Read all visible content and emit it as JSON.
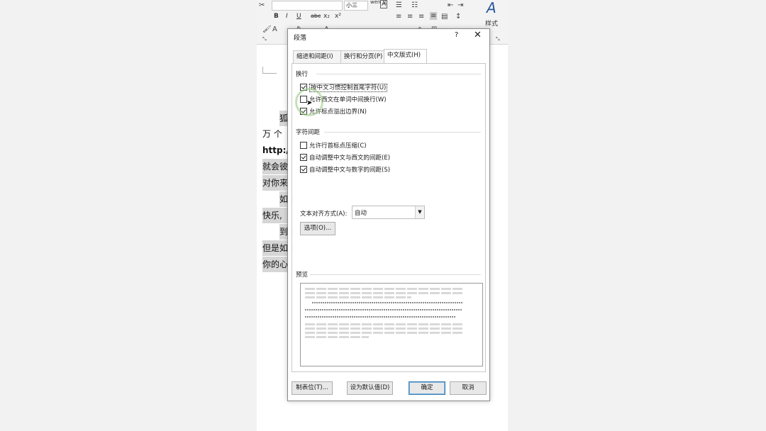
{
  "ribbon": {
    "font_size_value": "小三",
    "phonetic_label": "wén\n文",
    "styles_label": "样式",
    "bold": "B",
    "italic": "I",
    "underline": "U",
    "strike": "abc",
    "subscript": "x₂",
    "superscript": "x²"
  },
  "document": {
    "lines": [
      "狐",
      "万 个",
      "http://",
      "就会彼",
      "对你来",
      "如",
      "快乐,",
      "到",
      "但是如",
      "你的心"
    ]
  },
  "dialog": {
    "title": "段落",
    "help": "?",
    "close": "✕",
    "tabs": [
      "缩进和间距(I)",
      "换行和分页(P)",
      "中文版式(H)"
    ],
    "section_wrap": {
      "title": "换行",
      "items": [
        {
          "label": "按中文习惯控制首尾字符(U)",
          "checked": true
        },
        {
          "label": "允许西文在单词中间换行(W)",
          "checked": false
        },
        {
          "label": "允许标点溢出边界(N)",
          "checked": true
        }
      ]
    },
    "section_spacing": {
      "title": "字符间距",
      "items": [
        {
          "label": "允许行首标点压缩(C)",
          "checked": false
        },
        {
          "label": "自动调整中文与西文的间距(E)",
          "checked": true
        },
        {
          "label": "自动调整中文与数字的间距(S)",
          "checked": true
        }
      ]
    },
    "text_align": {
      "label": "文本对齐方式(A):",
      "value": "自动"
    },
    "options_button": "选项(O)...",
    "preview_title": "预览",
    "buttons": {
      "tabs": "制表位(T)...",
      "default": "设为默认值(D)",
      "ok": "确定",
      "cancel": "取消"
    }
  },
  "colors": {
    "accent": "#2b579a",
    "highlight": "#d6d6d6"
  }
}
